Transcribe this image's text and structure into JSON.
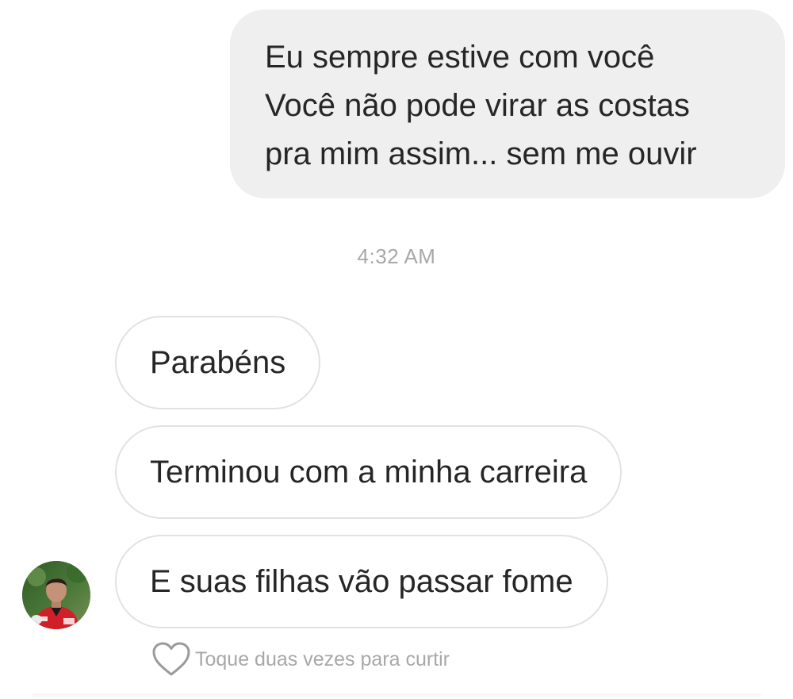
{
  "thread": {
    "sent_message": {
      "lines": [
        "Eu sempre estive com você",
        "Você não pode virar as costas",
        "pra mim assim... sem me ouvir"
      ]
    },
    "timestamp": "4:32 AM",
    "received_messages": [
      "Parabéns",
      "Terminou com a minha carreira",
      "E suas filhas vão passar fome"
    ],
    "like_hint": "Toque duas vezes para curtir",
    "icons": {
      "avatar": "avatar",
      "like": "heart-outline-icon"
    },
    "colors": {
      "sent_bubble": "#efefef",
      "received_border": "#e2e2e2",
      "text": "#262626",
      "muted": "#a8a8a8"
    }
  }
}
